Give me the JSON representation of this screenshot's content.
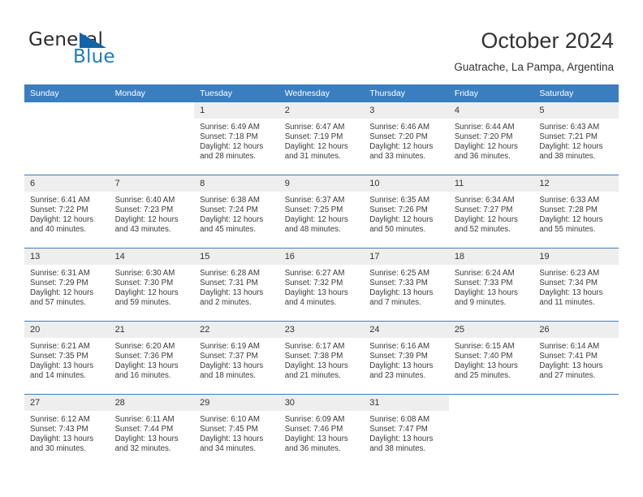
{
  "brand": {
    "name_part1": "General",
    "name_part2": "Blue"
  },
  "header": {
    "title": "October 2024",
    "subtitle": "Guatrache, La Pampa, Argentina"
  },
  "colors": {
    "header_blue": "#3a7ec0",
    "brand_blue": "#1f7bc1",
    "triangle_blue": "#1064a8",
    "daynum_bg": "#eeeeee",
    "text": "#333333"
  },
  "weekday_headers": [
    "Sunday",
    "Monday",
    "Tuesday",
    "Wednesday",
    "Thursday",
    "Friday",
    "Saturday"
  ],
  "weeks": [
    [
      {
        "day": "",
        "sunrise": "",
        "sunset": "",
        "daylight1": "",
        "daylight2": "",
        "blank": true
      },
      {
        "day": "",
        "sunrise": "",
        "sunset": "",
        "daylight1": "",
        "daylight2": "",
        "blank": true
      },
      {
        "day": "1",
        "sunrise": "Sunrise: 6:49 AM",
        "sunset": "Sunset: 7:18 PM",
        "daylight1": "Daylight: 12 hours",
        "daylight2": "and 28 minutes."
      },
      {
        "day": "2",
        "sunrise": "Sunrise: 6:47 AM",
        "sunset": "Sunset: 7:19 PM",
        "daylight1": "Daylight: 12 hours",
        "daylight2": "and 31 minutes."
      },
      {
        "day": "3",
        "sunrise": "Sunrise: 6:46 AM",
        "sunset": "Sunset: 7:20 PM",
        "daylight1": "Daylight: 12 hours",
        "daylight2": "and 33 minutes."
      },
      {
        "day": "4",
        "sunrise": "Sunrise: 6:44 AM",
        "sunset": "Sunset: 7:20 PM",
        "daylight1": "Daylight: 12 hours",
        "daylight2": "and 36 minutes."
      },
      {
        "day": "5",
        "sunrise": "Sunrise: 6:43 AM",
        "sunset": "Sunset: 7:21 PM",
        "daylight1": "Daylight: 12 hours",
        "daylight2": "and 38 minutes."
      }
    ],
    [
      {
        "day": "6",
        "sunrise": "Sunrise: 6:41 AM",
        "sunset": "Sunset: 7:22 PM",
        "daylight1": "Daylight: 12 hours",
        "daylight2": "and 40 minutes."
      },
      {
        "day": "7",
        "sunrise": "Sunrise: 6:40 AM",
        "sunset": "Sunset: 7:23 PM",
        "daylight1": "Daylight: 12 hours",
        "daylight2": "and 43 minutes."
      },
      {
        "day": "8",
        "sunrise": "Sunrise: 6:38 AM",
        "sunset": "Sunset: 7:24 PM",
        "daylight1": "Daylight: 12 hours",
        "daylight2": "and 45 minutes."
      },
      {
        "day": "9",
        "sunrise": "Sunrise: 6:37 AM",
        "sunset": "Sunset: 7:25 PM",
        "daylight1": "Daylight: 12 hours",
        "daylight2": "and 48 minutes."
      },
      {
        "day": "10",
        "sunrise": "Sunrise: 6:35 AM",
        "sunset": "Sunset: 7:26 PM",
        "daylight1": "Daylight: 12 hours",
        "daylight2": "and 50 minutes."
      },
      {
        "day": "11",
        "sunrise": "Sunrise: 6:34 AM",
        "sunset": "Sunset: 7:27 PM",
        "daylight1": "Daylight: 12 hours",
        "daylight2": "and 52 minutes."
      },
      {
        "day": "12",
        "sunrise": "Sunrise: 6:33 AM",
        "sunset": "Sunset: 7:28 PM",
        "daylight1": "Daylight: 12 hours",
        "daylight2": "and 55 minutes."
      }
    ],
    [
      {
        "day": "13",
        "sunrise": "Sunrise: 6:31 AM",
        "sunset": "Sunset: 7:29 PM",
        "daylight1": "Daylight: 12 hours",
        "daylight2": "and 57 minutes."
      },
      {
        "day": "14",
        "sunrise": "Sunrise: 6:30 AM",
        "sunset": "Sunset: 7:30 PM",
        "daylight1": "Daylight: 12 hours",
        "daylight2": "and 59 minutes."
      },
      {
        "day": "15",
        "sunrise": "Sunrise: 6:28 AM",
        "sunset": "Sunset: 7:31 PM",
        "daylight1": "Daylight: 13 hours",
        "daylight2": "and 2 minutes."
      },
      {
        "day": "16",
        "sunrise": "Sunrise: 6:27 AM",
        "sunset": "Sunset: 7:32 PM",
        "daylight1": "Daylight: 13 hours",
        "daylight2": "and 4 minutes."
      },
      {
        "day": "17",
        "sunrise": "Sunrise: 6:25 AM",
        "sunset": "Sunset: 7:33 PM",
        "daylight1": "Daylight: 13 hours",
        "daylight2": "and 7 minutes."
      },
      {
        "day": "18",
        "sunrise": "Sunrise: 6:24 AM",
        "sunset": "Sunset: 7:33 PM",
        "daylight1": "Daylight: 13 hours",
        "daylight2": "and 9 minutes."
      },
      {
        "day": "19",
        "sunrise": "Sunrise: 6:23 AM",
        "sunset": "Sunset: 7:34 PM",
        "daylight1": "Daylight: 13 hours",
        "daylight2": "and 11 minutes."
      }
    ],
    [
      {
        "day": "20",
        "sunrise": "Sunrise: 6:21 AM",
        "sunset": "Sunset: 7:35 PM",
        "daylight1": "Daylight: 13 hours",
        "daylight2": "and 14 minutes."
      },
      {
        "day": "21",
        "sunrise": "Sunrise: 6:20 AM",
        "sunset": "Sunset: 7:36 PM",
        "daylight1": "Daylight: 13 hours",
        "daylight2": "and 16 minutes."
      },
      {
        "day": "22",
        "sunrise": "Sunrise: 6:19 AM",
        "sunset": "Sunset: 7:37 PM",
        "daylight1": "Daylight: 13 hours",
        "daylight2": "and 18 minutes."
      },
      {
        "day": "23",
        "sunrise": "Sunrise: 6:17 AM",
        "sunset": "Sunset: 7:38 PM",
        "daylight1": "Daylight: 13 hours",
        "daylight2": "and 21 minutes."
      },
      {
        "day": "24",
        "sunrise": "Sunrise: 6:16 AM",
        "sunset": "Sunset: 7:39 PM",
        "daylight1": "Daylight: 13 hours",
        "daylight2": "and 23 minutes."
      },
      {
        "day": "25",
        "sunrise": "Sunrise: 6:15 AM",
        "sunset": "Sunset: 7:40 PM",
        "daylight1": "Daylight: 13 hours",
        "daylight2": "and 25 minutes."
      },
      {
        "day": "26",
        "sunrise": "Sunrise: 6:14 AM",
        "sunset": "Sunset: 7:41 PM",
        "daylight1": "Daylight: 13 hours",
        "daylight2": "and 27 minutes."
      }
    ],
    [
      {
        "day": "27",
        "sunrise": "Sunrise: 6:12 AM",
        "sunset": "Sunset: 7:43 PM",
        "daylight1": "Daylight: 13 hours",
        "daylight2": "and 30 minutes."
      },
      {
        "day": "28",
        "sunrise": "Sunrise: 6:11 AM",
        "sunset": "Sunset: 7:44 PM",
        "daylight1": "Daylight: 13 hours",
        "daylight2": "and 32 minutes."
      },
      {
        "day": "29",
        "sunrise": "Sunrise: 6:10 AM",
        "sunset": "Sunset: 7:45 PM",
        "daylight1": "Daylight: 13 hours",
        "daylight2": "and 34 minutes."
      },
      {
        "day": "30",
        "sunrise": "Sunrise: 6:09 AM",
        "sunset": "Sunset: 7:46 PM",
        "daylight1": "Daylight: 13 hours",
        "daylight2": "and 36 minutes."
      },
      {
        "day": "31",
        "sunrise": "Sunrise: 6:08 AM",
        "sunset": "Sunset: 7:47 PM",
        "daylight1": "Daylight: 13 hours",
        "daylight2": "and 38 minutes."
      },
      {
        "day": "",
        "sunrise": "",
        "sunset": "",
        "daylight1": "",
        "daylight2": "",
        "blank": true
      },
      {
        "day": "",
        "sunrise": "",
        "sunset": "",
        "daylight1": "",
        "daylight2": "",
        "blank": true
      }
    ]
  ]
}
